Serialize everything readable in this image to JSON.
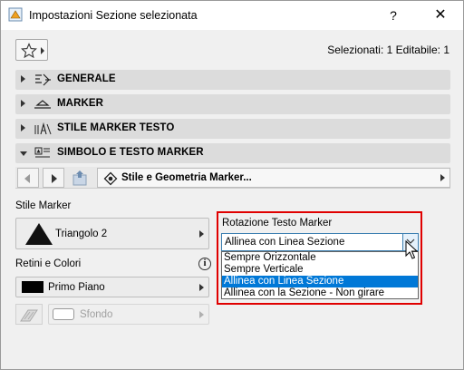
{
  "window": {
    "title": "Impostazioni Sezione selezionata",
    "help_label": "?",
    "close_label": "✕"
  },
  "favorites": {
    "icon": "star-icon"
  },
  "selection_info": "Selezionati: 1 Editabile: 1",
  "panels": [
    {
      "label": "GENERALE",
      "icon": "general-settings-icon",
      "expanded": false
    },
    {
      "label": "MARKER",
      "icon": "marker-icon",
      "expanded": false
    },
    {
      "label": "STILE MARKER TESTO",
      "icon": "text-style-icon",
      "expanded": false
    },
    {
      "label": "SIMBOLO E TESTO MARKER",
      "icon": "symbol-text-icon",
      "expanded": true
    }
  ],
  "nav": {
    "page_label": "Stile e Geometria Marker...",
    "page_icon": "geometry-icon"
  },
  "marker_style": {
    "heading": "Stile Marker",
    "value": "Triangolo 2"
  },
  "pens": {
    "heading": "Retini e Colori",
    "foreground_label": "Primo Piano",
    "background_label": "Sfondo"
  },
  "rotation": {
    "heading": "Rotazione Testo Marker",
    "current_value": "Allinea con Linea Sezione",
    "options": [
      {
        "label": "Sempre Orizzontale",
        "selected": false
      },
      {
        "label": "Sempre Verticale",
        "selected": false
      },
      {
        "label": "Allinea con Linea Sezione",
        "selected": true
      },
      {
        "label": "Allinea con la Sezione - Non girare",
        "selected": false
      }
    ]
  },
  "colors": {
    "selection_highlight": "#0078d7",
    "highlight_frame": "#e00000",
    "panel_header": "#dcdcdc"
  }
}
